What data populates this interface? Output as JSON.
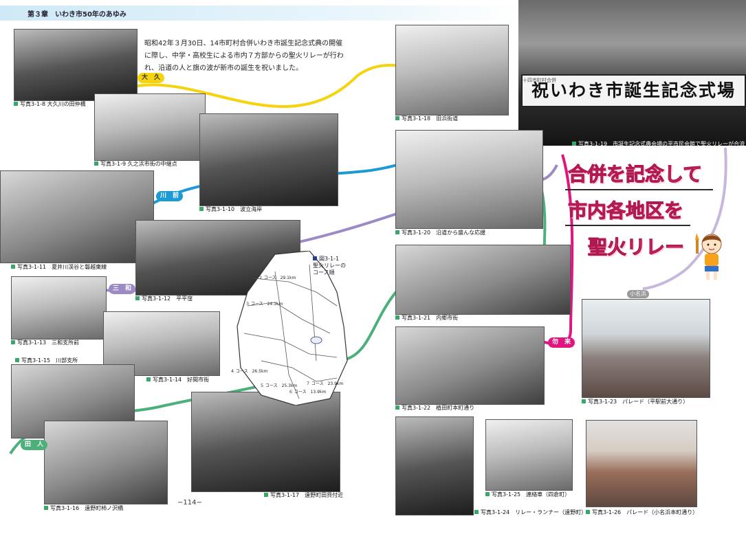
{
  "header": {
    "chapter_title": "第３章　いわき市50年のあゆみ"
  },
  "intro_text": "昭和42年３月30日、14市町村合併いわき市誕生記念式典の開催に際し、中学・高校生による市内７方部からの聖火リレーが行われ、沿道の人と旗の波が新市の誕生を祝いました。",
  "banner": {
    "sign_text": "祝いわき市誕生記念式場",
    "sign_sub": "十四市町村合併"
  },
  "feature_title": {
    "line1": "合併を記念して",
    "line2": "市内各地区を",
    "line3": "聖火リレー"
  },
  "area_tags": {
    "ohisa": "大　久",
    "kawamae": "川　前",
    "miwa": "三　和",
    "tabito": "田　人",
    "nakoso": "勿　来",
    "onahama": "小名浜"
  },
  "map": {
    "caption_number": "図3-1-1",
    "caption_text": "聖火リレーの",
    "caption_text2": "コース順",
    "labels": {
      "c2": "２ コース　29.1km",
      "c3": "３ コース　24.1km",
      "c4": "４ コース　26.5km",
      "c5": "５ コース　25.3km",
      "c6": "６ コース　13.9km",
      "c7": "７ コース　23.9km"
    }
  },
  "photos": [
    {
      "id": "p8",
      "caption": "写真3-1-8  大久川の田仲橋"
    },
    {
      "id": "p9",
      "caption": "写真3-1-9  久之浜市街の中継点"
    },
    {
      "id": "p10",
      "caption": "写真3-1-10　波立海岸"
    },
    {
      "id": "p11",
      "caption": "写真3-1-11　夏井川渓谷と磐越東線"
    },
    {
      "id": "p12",
      "caption": "写真3-1-12　平平窪"
    },
    {
      "id": "p13",
      "caption": "写真3-1-13　三和支所前"
    },
    {
      "id": "p14",
      "caption": "写真3-1-14　好間市街"
    },
    {
      "id": "p15",
      "caption": "写真3-1-15　川部支所"
    },
    {
      "id": "p16",
      "caption": "写真3-1-16　遠野町柿ノ沢橋"
    },
    {
      "id": "p17",
      "caption": "写真3-1-17　遠野町田貝付近"
    },
    {
      "id": "p18",
      "caption": "写真3-1-18　旧浜街道"
    },
    {
      "id": "p19",
      "caption": "写真3-1-19　市誕生記念式典会場の平市民会館で聖火リレーが合流"
    },
    {
      "id": "p20",
      "caption": "写真3-1-20　沿道から盛んな応援"
    },
    {
      "id": "p21",
      "caption": "写真3-1-21　内郷市街"
    },
    {
      "id": "p22",
      "caption": "写真3-1-22　植田町本町通り"
    },
    {
      "id": "p23",
      "caption": "写真3-1-23　パレード（平駅前大通り）"
    },
    {
      "id": "p24",
      "caption": "写真3-1-24　リレー・ランナー（遠野町）"
    },
    {
      "id": "p25",
      "caption": "写真3-1-25　連絡車（四倉町）"
    },
    {
      "id": "p26",
      "caption": "写真3-1-26　パレード（小名浜本町通り）"
    }
  ],
  "page_number": "−114−",
  "colors": {
    "yellow": "#f5d40f",
    "blue": "#1b9ad6",
    "purple": "#9c8ac4",
    "green": "#4db07a",
    "pink": "#e0157f",
    "lavender": "#c7b7dd"
  }
}
